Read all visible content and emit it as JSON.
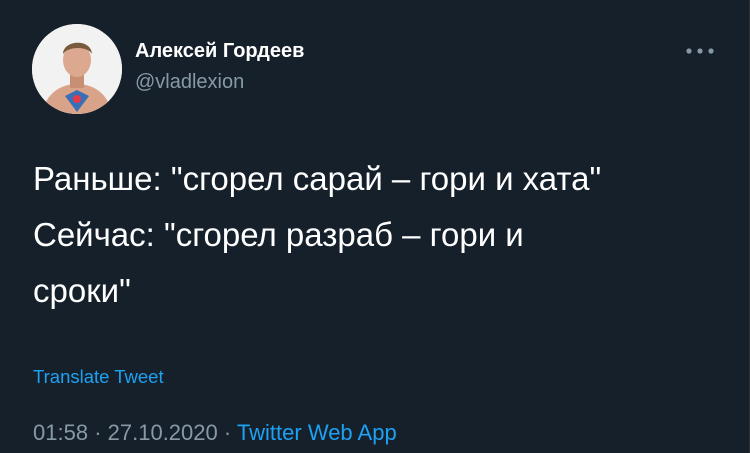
{
  "tweet": {
    "author": {
      "display_name": "Алексей Гордеев",
      "handle": "@vladlexion"
    },
    "text": "Раньше: \"сгорел сарай – гори и хата\"\nСейчас: \"сгорел разраб – гори и\nсроки\"",
    "translate_label": "Translate Tweet",
    "time": "01:58",
    "separator": "·",
    "date": "27.10.2020",
    "source": "Twitter Web App"
  },
  "colors": {
    "background": "#15202b",
    "text": "#ffffff",
    "secondary_text": "#8899a6",
    "accent": "#1da1f2"
  },
  "icons": {
    "more": "more-horizontal-icon"
  }
}
